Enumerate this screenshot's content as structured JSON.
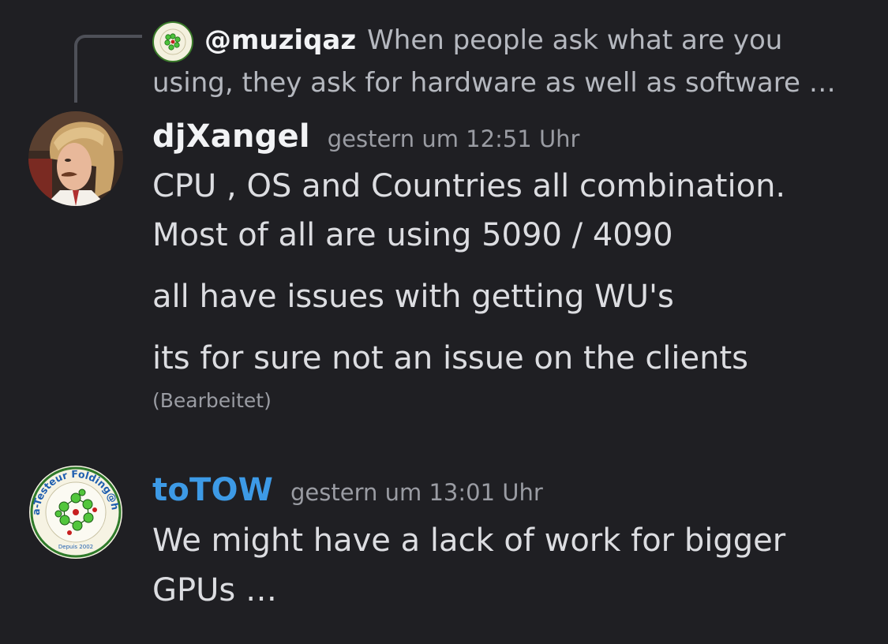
{
  "reply_preview": {
    "author": "@muziqaz",
    "excerpt": "When people ask what are you using, they ask for hardware as well as software …"
  },
  "messages": [
    {
      "author": "djXangel",
      "author_color": "#f2f3f5",
      "timestamp": "gestern um 12:51 Uhr",
      "lines": [
        "CPU , OS and Countries all combination.",
        "Most of all are using 5090 / 4090",
        "all have issues with getting WU's",
        "its for sure not an issue on the clients"
      ],
      "edited_label": "(Bearbeitet)"
    },
    {
      "author": "toTOW",
      "author_color": "#3d9ae6",
      "timestamp": "gestern um 13:01 Uhr",
      "lines": [
        "We might have a lack of work for bigger",
        "GPUs …"
      ]
    }
  ],
  "badge": {
    "ring_text": "Béta-Testeur Folding@home",
    "footer_text": "Depuis 2002"
  },
  "colors": {
    "background": "#1f1f23",
    "text": "#dcdde1",
    "muted": "#9a9ca3",
    "reply_line": "#4e5058",
    "totow_name": "#3d9ae6"
  }
}
